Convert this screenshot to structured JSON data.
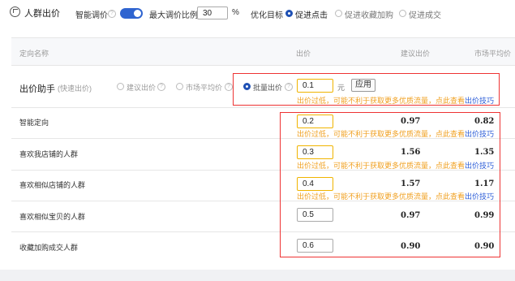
{
  "topbar": {
    "title": "人群出价",
    "smart_bid_label": "智能调价",
    "smart_bid_on": true,
    "max_ratio_label": "最大调价比例",
    "max_ratio_value": "30",
    "max_ratio_unit": "%",
    "goal_label": "优化目标",
    "goal_options": [
      "促进点击",
      "促进收藏加购",
      "促进成交"
    ],
    "goal_selected": 0
  },
  "table_header": {
    "col_name": "定向名称",
    "col_bid": "出价",
    "col_suggest": "建议出价",
    "col_market": "市场平均价"
  },
  "helper": {
    "title": "出价助手",
    "subtitle": "(快速出价)",
    "options": [
      "建议出价",
      "市场平均价",
      "批量出价"
    ],
    "selected": 2,
    "input_value": "0.1",
    "unit": "元",
    "apply_label": "应用",
    "warning": "出价过低，可能不利于获取更多优质流量，点此查看",
    "warning_link": "出价技巧"
  },
  "rows": [
    {
      "name": "智能定向",
      "bid": "0.2",
      "suggest": "0.97",
      "market": "0.82",
      "warning": "出价过低，可能不利于获取更多优质流量，点此查看",
      "warning_link": "出价技巧"
    },
    {
      "name": "喜欢我店铺的人群",
      "bid": "0.3",
      "suggest": "1.56",
      "market": "1.35",
      "warning": "出价过低，可能不利于获取更多优质流量，点此查看",
      "warning_link": "出价技巧"
    },
    {
      "name": "喜欢相似店铺的人群",
      "bid": "0.4",
      "suggest": "1.57",
      "market": "1.17",
      "warning": "出价过低，可能不利于获取更多优质流量，点此查看",
      "warning_link": "出价技巧"
    },
    {
      "name": "喜欢相似宝贝的人群",
      "bid": "0.5",
      "suggest": "0.97",
      "market": "0.99"
    },
    {
      "name": "收藏加购成交人群",
      "bid": "0.6",
      "suggest": "0.90",
      "market": "0.90"
    }
  ],
  "colors": {
    "accent": "#1e50b4",
    "warning": "#f0a020",
    "highlight_box": "#e33333",
    "link": "#2a5bd7"
  }
}
